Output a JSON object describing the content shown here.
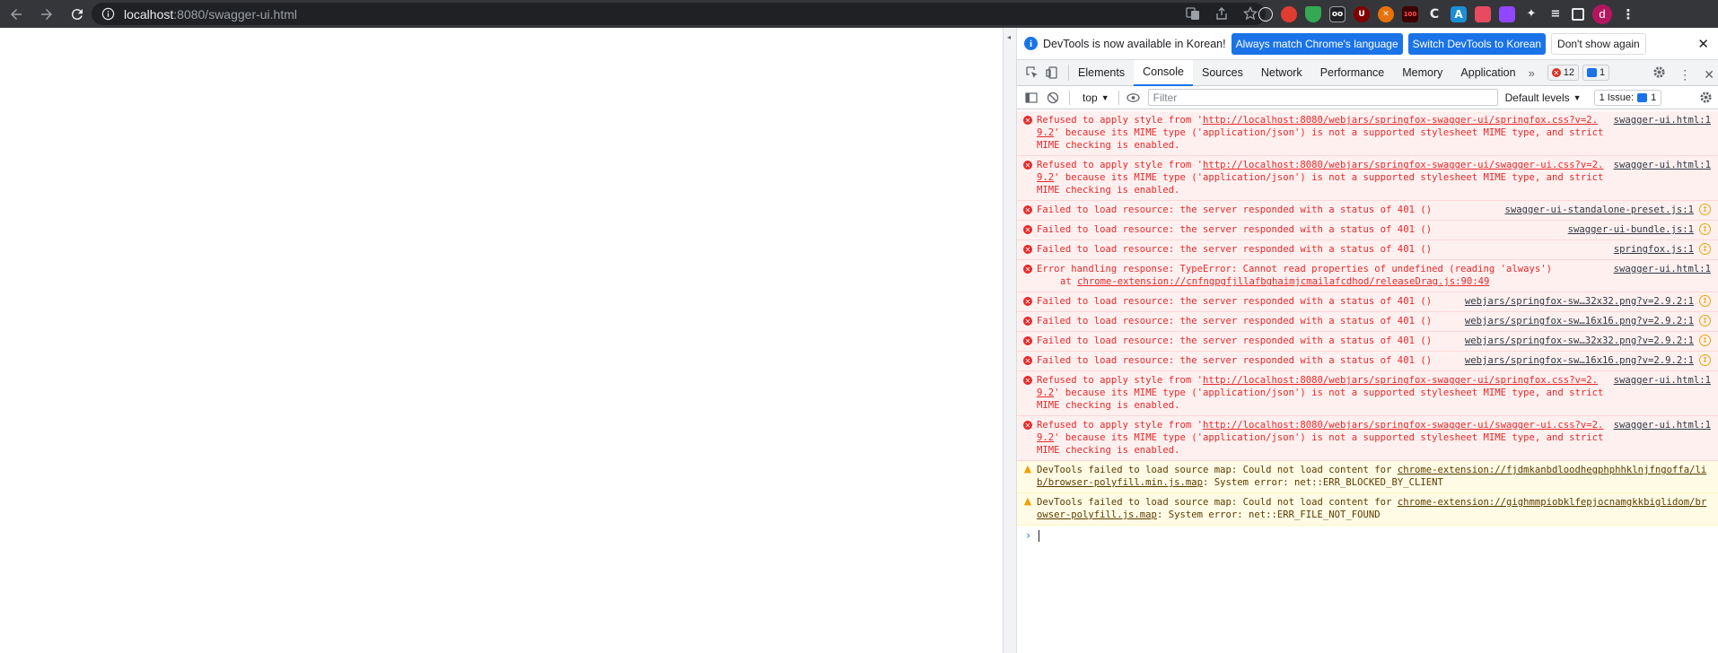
{
  "browser": {
    "url_host": "localhost",
    "url_rest": ":8080/swagger-ui.html",
    "profile_initial": "d",
    "extensions": [
      "translate-icon",
      "share-icon",
      "bookmark-star-icon",
      "globe-icon",
      "adblock-icon",
      "shield-icon",
      "ext-icon",
      "ublock-icon",
      "pdf-icon",
      "ext-icon",
      "c-icon",
      "a-icon",
      "ext-icon",
      "twitch-icon"
    ]
  },
  "devtools": {
    "infobar": {
      "message": "DevTools is now available in Korean!",
      "match_button": "Always match Chrome's language",
      "switch_button": "Switch DevTools to Korean",
      "dismiss_button": "Don't show again"
    },
    "tabs": [
      "Elements",
      "Console",
      "Sources",
      "Network",
      "Performance",
      "Memory",
      "Application"
    ],
    "active_tab": "Console",
    "error_count": "12",
    "message_count": "1",
    "toolbar": {
      "context": "top",
      "filter_placeholder": "Filter",
      "levels": "Default levels",
      "issues": "1 Issue:",
      "issues_count": "1"
    },
    "messages": [
      {
        "type": "error",
        "text_a": "Refused to apply style from '",
        "link": "http://localhost:8080/webjars/springfox-swagger-ui/springfox.css?v=2.9.2",
        "text_b": "' because its MIME type ('application/json') is not a supported stylesheet MIME type, and strict MIME checking is enabled.",
        "source": "swagger-ui.html:1"
      },
      {
        "type": "error",
        "text_a": "Refused to apply style from '",
        "link": "http://localhost:8080/webjars/springfox-swagger-ui/swagger-ui.css?v=2.9.2",
        "text_b": "' because its MIME type ('application/json') is not a supported stylesheet MIME type, and strict MIME checking is enabled.",
        "source": "swagger-ui.html:1"
      },
      {
        "type": "error",
        "text_a": "Failed to load resource: the server responded with a status of 401 ()",
        "link": "",
        "text_b": "",
        "source": "swagger-ui-standalone-preset.js:1",
        "net": true
      },
      {
        "type": "error",
        "text_a": "Failed to load resource: the server responded with a status of 401 ()",
        "link": "",
        "text_b": "",
        "source": "swagger-ui-bundle.js:1",
        "net": true
      },
      {
        "type": "error",
        "text_a": "Failed to load resource: the server responded with a status of 401 ()",
        "link": "",
        "text_b": "",
        "source": "springfox.js:1",
        "net": true
      },
      {
        "type": "error",
        "text_a": "Error handling response: TypeError: Cannot read properties of undefined (reading 'always')",
        "link": "",
        "text_b": "",
        "source": "swagger-ui.html:1",
        "stack_pre": "at ",
        "stack_link": "chrome-extension://cnfngpgfjllafbghaimjcmailafcdhod/releaseDrag.js:90:49"
      },
      {
        "type": "error",
        "text_a": "Failed to load resource: the server responded with a status of 401 ()",
        "link": "",
        "text_b": "",
        "source": "webjars/springfox-sw…32x32.png?v=2.9.2:1",
        "net": true
      },
      {
        "type": "error",
        "text_a": "Failed to load resource: the server responded with a status of 401 ()",
        "link": "",
        "text_b": "",
        "source": "webjars/springfox-sw…16x16.png?v=2.9.2:1",
        "net": true
      },
      {
        "type": "error",
        "text_a": "Failed to load resource: the server responded with a status of 401 ()",
        "link": "",
        "text_b": "",
        "source": "webjars/springfox-sw…32x32.png?v=2.9.2:1",
        "net": true
      },
      {
        "type": "error",
        "text_a": "Failed to load resource: the server responded with a status of 401 ()",
        "link": "",
        "text_b": "",
        "source": "webjars/springfox-sw…16x16.png?v=2.9.2:1",
        "net": true
      },
      {
        "type": "error",
        "text_a": "Refused to apply style from '",
        "link": "http://localhost:8080/webjars/springfox-swagger-ui/springfox.css?v=2.9.2",
        "text_b": "' because its MIME type ('application/json') is not a supported stylesheet MIME type, and strict MIME checking is enabled.",
        "source": "swagger-ui.html:1"
      },
      {
        "type": "error",
        "text_a": "Refused to apply style from '",
        "link": "http://localhost:8080/webjars/springfox-swagger-ui/swagger-ui.css?v=2.9.2",
        "text_b": "' because its MIME type ('application/json') is not a supported stylesheet MIME type, and strict MIME checking is enabled.",
        "source": "swagger-ui.html:1"
      },
      {
        "type": "warn",
        "text_a": "DevTools failed to load source map: Could not load content for ",
        "link": "chrome-extension://fjdmkanbdloodhegphphhklnjfngoffa/lib/browser-polyfill.min.js.map",
        "text_b": ": System error: net::ERR_BLOCKED_BY_CLIENT",
        "source": ""
      },
      {
        "type": "warn",
        "text_a": "DevTools failed to load source map: Could not load content for ",
        "link": "chrome-extension://gighmmpiobklfepjocnamgkkbiglidom/browser-polyfill.js.map",
        "text_b": ": System error: net::ERR_FILE_NOT_FOUND",
        "source": ""
      }
    ],
    "prompt_symbol": "›"
  }
}
